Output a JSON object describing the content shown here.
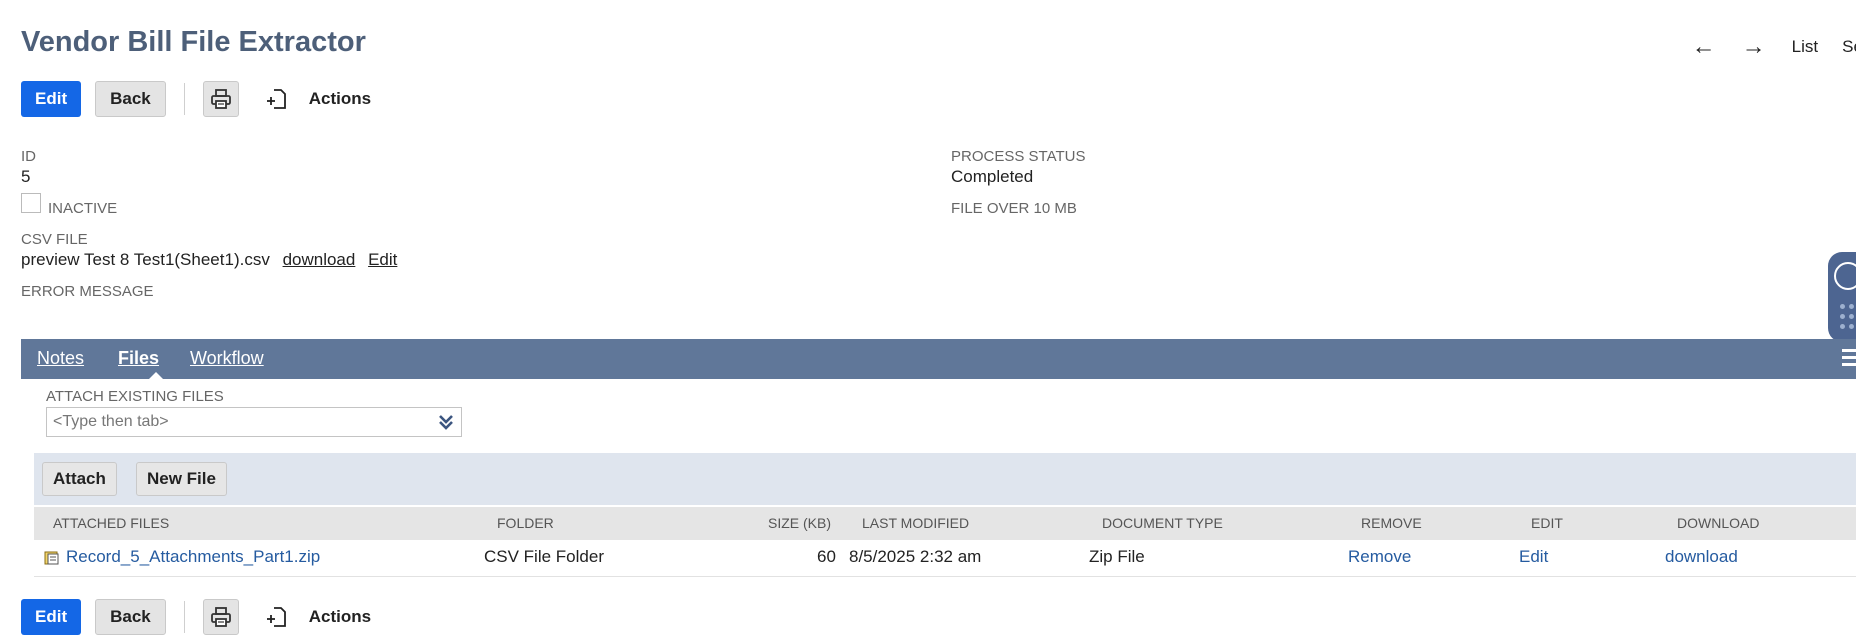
{
  "page": {
    "title": "Vendor Bill File Extractor"
  },
  "topnav": {
    "prev_icon": "arrow-left-icon",
    "next_icon": "arrow-right-icon",
    "list_label": "List",
    "search_label": "Search"
  },
  "toolbar": {
    "edit_label": "Edit",
    "back_label": "Back",
    "print_icon": "printer-icon",
    "actions_icon": "new-document-icon",
    "actions_label": "Actions"
  },
  "fields": {
    "id_label": "ID",
    "id_value": "5",
    "inactive_label": "INACTIVE",
    "csv_label": "CSV FILE",
    "csv_filename": "preview Test 8 Test1(Sheet1).csv",
    "csv_download": "download",
    "csv_edit": "Edit",
    "error_label": "ERROR MESSAGE",
    "process_status_label": "PROCESS STATUS",
    "process_status_value": "Completed",
    "file_over_label": "FILE OVER 10 MB"
  },
  "tabs": [
    {
      "label": "Notes",
      "active": false
    },
    {
      "label": "Files",
      "active": true
    },
    {
      "label": "Workflow",
      "active": false
    }
  ],
  "files": {
    "attach_label": "ATTACH EXISTING FILES",
    "attach_placeholder": "<Type then tab>",
    "attach_button": "Attach",
    "new_file_button": "New File",
    "columns": [
      "ATTACHED FILES",
      "FOLDER",
      "SIZE (KB)",
      "LAST MODIFIED",
      "DOCUMENT TYPE",
      "REMOVE",
      "EDIT",
      "DOWNLOAD"
    ],
    "rows": [
      {
        "name": "Record_5_Attachments_Part1.zip",
        "folder": "CSV File Folder",
        "size": "60",
        "modified": "8/5/2025 2:32 am",
        "doctype": "Zip File",
        "remove": "Remove",
        "edit": "Edit",
        "download": "download"
      }
    ]
  },
  "colors": {
    "primary": "#1467e6",
    "title": "#4d5f79",
    "tabbar": "#607799",
    "link": "#255ba0",
    "toolbar_bg": "#dfe5ee"
  }
}
